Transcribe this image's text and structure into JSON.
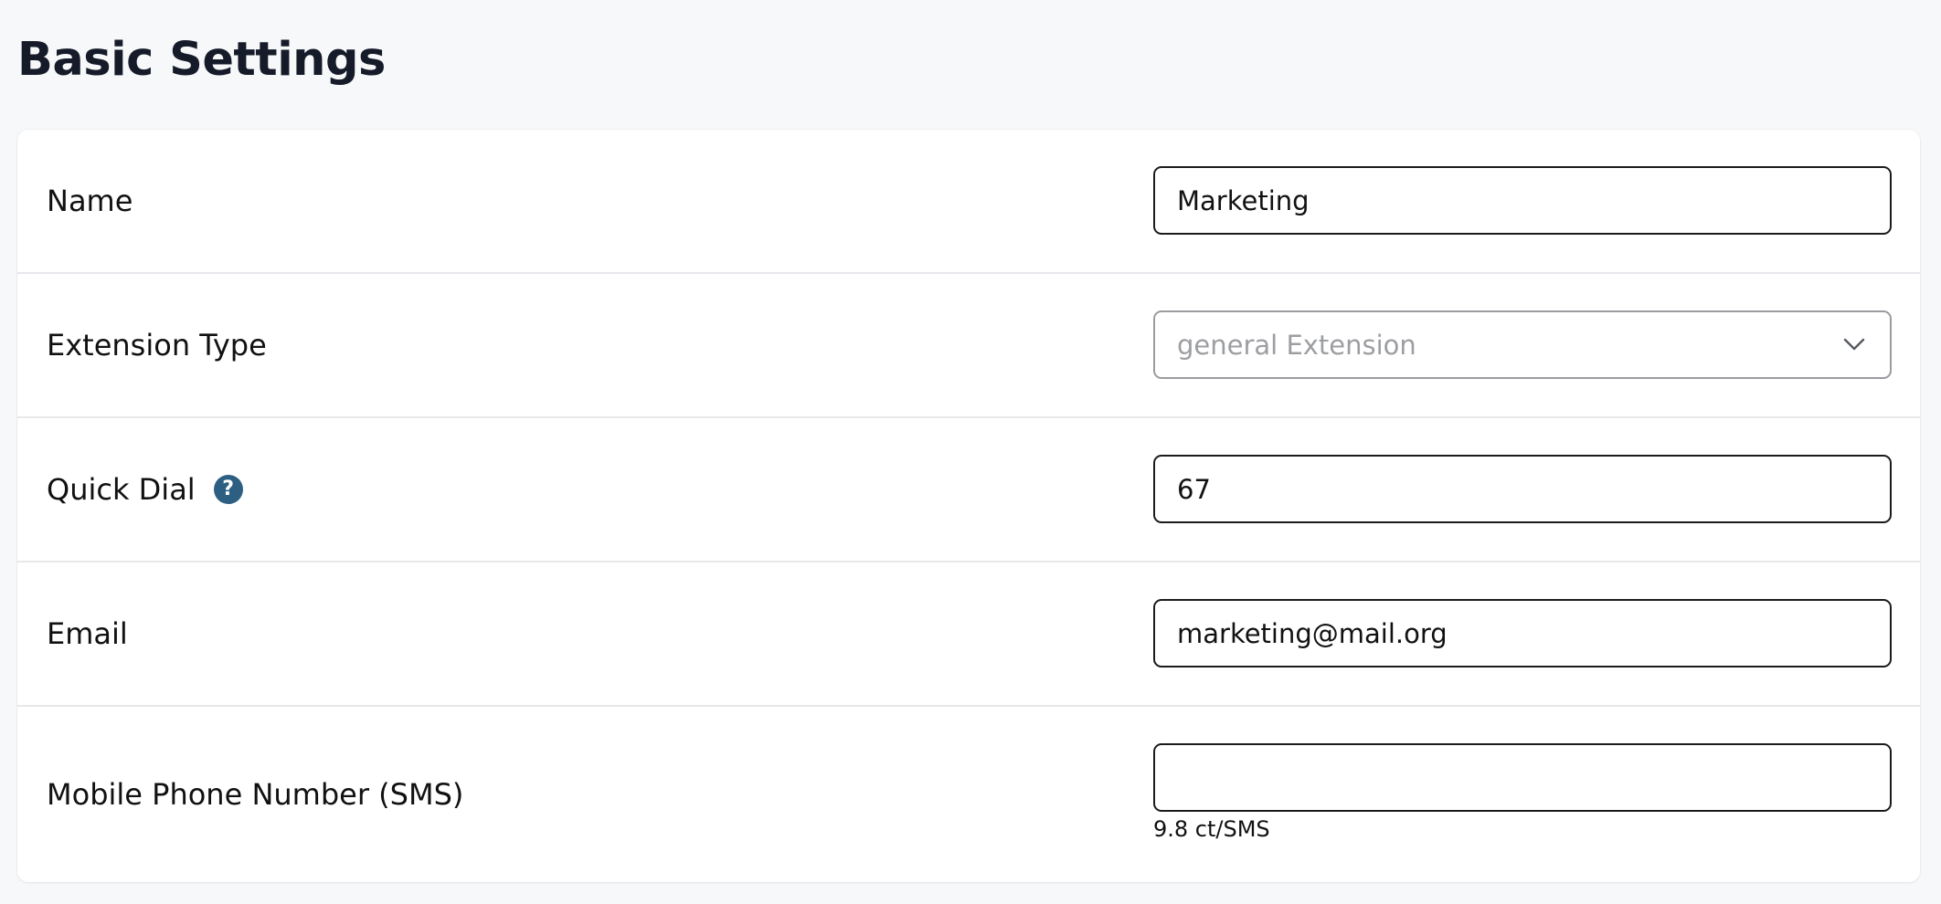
{
  "page": {
    "title": "Basic Settings"
  },
  "form": {
    "name": {
      "label": "Name",
      "value": "Marketing"
    },
    "extension_type": {
      "label": "Extension Type",
      "selected": "general Extension",
      "icon": "chevron-down-icon"
    },
    "quick_dial": {
      "label": "Quick Dial",
      "value": "67",
      "help_icon": "help-icon",
      "help_glyph": "?"
    },
    "email": {
      "label": "Email",
      "value": "marketing@mail.org"
    },
    "mobile": {
      "label": "Mobile Phone Number (SMS)",
      "value": "",
      "hint": "9.8 ct/SMS"
    }
  },
  "colors": {
    "background": "#f7f8fa",
    "card": "#ffffff",
    "help_icon": "#2d5f82",
    "title": "#161b2a"
  }
}
